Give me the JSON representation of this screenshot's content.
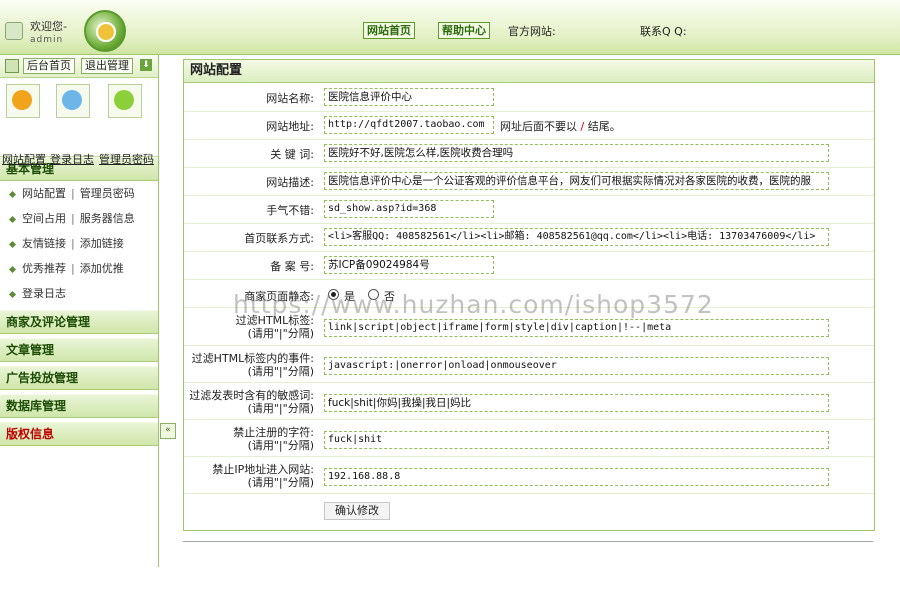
{
  "header": {
    "welcome": "欢迎您-",
    "username": "admin",
    "nav_home": "网站首页",
    "nav_help": "帮助中心",
    "official_site_label": "官方网站:",
    "contact_qq_label": "联系Q Q:"
  },
  "sidebar": {
    "toolbar": {
      "home": "后台首页",
      "logout": "退出管理"
    },
    "quick_links": [
      "网站配置",
      "登录日志",
      "管理员密码"
    ],
    "sections": [
      {
        "title": "基本管理",
        "items": [
          [
            "网站配置",
            "管理员密码"
          ],
          [
            "空间占用",
            "服务器信息"
          ],
          [
            "友情链接",
            "添加链接"
          ],
          [
            "优秀推荐",
            "添加优推"
          ],
          [
            "登录日志"
          ]
        ]
      },
      {
        "title": "商家及评论管理"
      },
      {
        "title": "文章管理"
      },
      {
        "title": "广告投放管理"
      },
      {
        "title": "数据库管理"
      },
      {
        "title": "版权信息"
      }
    ],
    "collapse_glyph": "«"
  },
  "panel": {
    "title": "网站配置",
    "fields": {
      "site_name": {
        "label": "网站名称:",
        "value": "医院信息评价中心"
      },
      "site_url": {
        "label": "网站地址:",
        "value": "http://qfdt2007.taobao.com",
        "note_a": "网址后面不要以",
        "note_slash": "/",
        "note_b": "结尾。"
      },
      "keywords": {
        "label": "关 键 词:",
        "value": "医院好不好,医院怎么样,医院收费合理吗"
      },
      "description": {
        "label": "网站描述:",
        "value": "医院信息评价中心是一个公证客观的评价信息平台，网友们可根据实际情况对各家医院的收费，医院的服"
      },
      "lucky": {
        "label": "手气不错:",
        "value": "sd_show.asp?id=368"
      },
      "contact": {
        "label": "首页联系方式:",
        "value": "<li>客服QQ: 408582561</li><li>邮箱: 408582561@qq.com</li><li>电话: 13703476009</li>"
      },
      "icp": {
        "label": "备 案 号:",
        "value": "苏ICP备09024984号"
      },
      "static": {
        "label": "商家页面静态:",
        "yes": "是",
        "no": "否"
      },
      "filter_html": {
        "label": "过滤HTML标签:",
        "hint": "(请用\"|\"分隔)",
        "value": "link|script|object|iframe|form|style|div|caption|!--|meta"
      },
      "filter_events": {
        "label": "过滤HTML标签内的事件:",
        "hint": "(请用\"|\"分隔)",
        "value": "javascript:|onerror|onload|onmouseover"
      },
      "filter_words": {
        "label": "过滤发表时含有的敏感词:",
        "hint": "(请用\"|\"分隔)",
        "value": "fuck|shit|你妈|我操|我日|妈比"
      },
      "ban_chars": {
        "label": "禁止注册的字符:",
        "hint": "(请用\"|\"分隔)",
        "value": "fuck|shit"
      },
      "ban_ip": {
        "label": "禁止IP地址进入网站:",
        "hint": "(请用\"|\"分隔)",
        "value": "192.168.88.8"
      }
    },
    "submit": "确认修改"
  },
  "watermark": "https://www.huzhan.com/ishop3572"
}
